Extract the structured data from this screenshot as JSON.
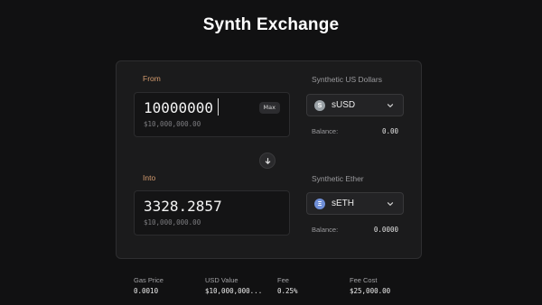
{
  "title": "Synth Exchange",
  "from": {
    "label": "From",
    "amount": "10000000",
    "usd_value": "$10,000,000.00",
    "max_label": "Max",
    "currency_label": "Synthetic US Dollars",
    "token": "sUSD",
    "token_icon": "S",
    "token_color": "#9aa1a6",
    "balance_label": "Balance:",
    "balance_value": "0.00"
  },
  "into": {
    "label": "Into",
    "amount": "3328.2857",
    "usd_value": "$10,000,000.00",
    "currency_label": "Synthetic Ether",
    "token": "sETH",
    "token_icon": "Ξ",
    "token_color": "#6f8fd8",
    "balance_label": "Balance:",
    "balance_value": "0.0000"
  },
  "stats": [
    {
      "label": "Gas Price",
      "value": "0.0010"
    },
    {
      "label": "USD Value",
      "value": "$10,000,000..."
    },
    {
      "label": "Fee",
      "value": "0.25%"
    },
    {
      "label": "Fee Cost",
      "value": "$25,000.00"
    }
  ],
  "colors": {
    "background": "#111112",
    "card": "#1b1b1c",
    "accent_label": "#d49b6e"
  },
  "icons": {
    "swap": "arrow-down-icon",
    "dropdown": "chevron-down-icon"
  }
}
